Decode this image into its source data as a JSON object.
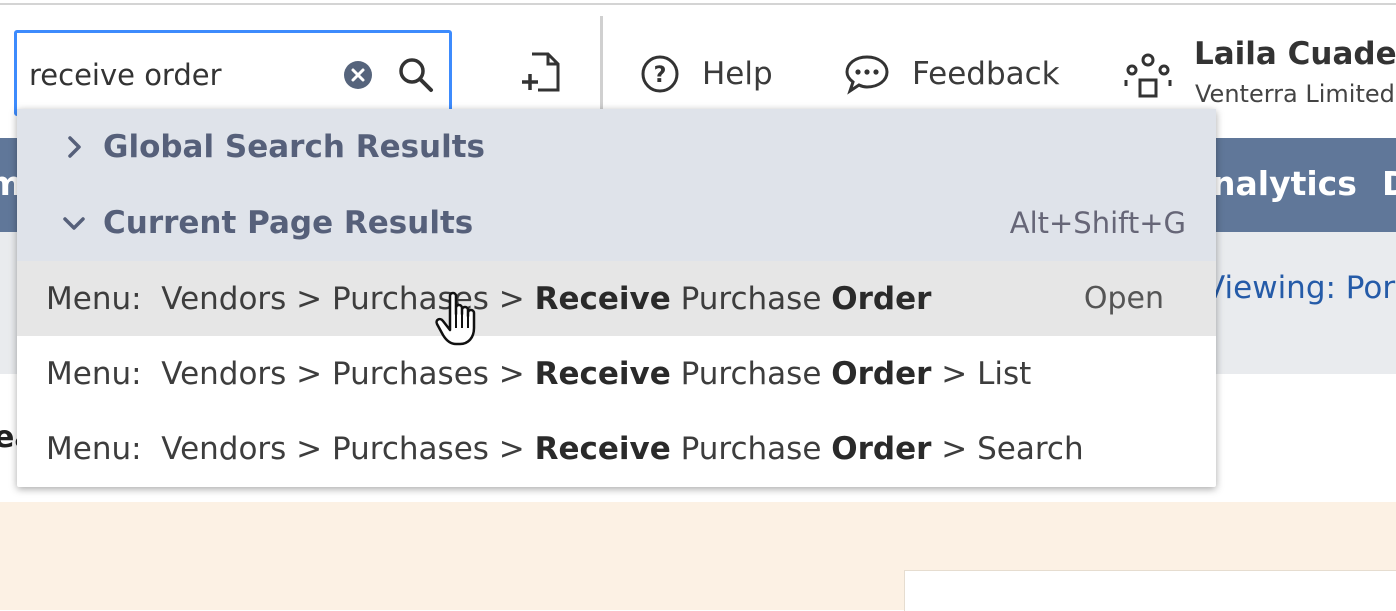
{
  "search": {
    "value": "receive order"
  },
  "header": {
    "help_label": "Help",
    "feedback_label": "Feedback",
    "user_name": "Laila Cuadern",
    "user_company": "Venterra Limited"
  },
  "nav": {
    "left_partial": "m",
    "analytics_partial": "nalytics",
    "right_partial": "D"
  },
  "subbar": {
    "viewing_partial": "Viewing: Port"
  },
  "page": {
    "fragment": "ea"
  },
  "dropdown": {
    "global_section": "Global Search Results",
    "current_section": "Current Page Results",
    "shortcut": "Alt+Shift+G",
    "results": [
      {
        "prefix": "Menu:  Vendors > Purchases > ",
        "b1": "Receive",
        "mid": " Purchase ",
        "b2": "Order",
        "suffix": "",
        "action": "Open"
      },
      {
        "prefix": "Menu:  Vendors > Purchases > ",
        "b1": "Receive",
        "mid": " Purchase ",
        "b2": "Order",
        "suffix": " > List"
      },
      {
        "prefix": "Menu:  Vendors > Purchases > ",
        "b1": "Receive",
        "mid": " Purchase ",
        "b2": "Order",
        "suffix": " > Search"
      }
    ]
  },
  "icons": {
    "clear": "clear-icon",
    "search": "search-icon",
    "new_record": "new-record-icon",
    "help": "help-icon",
    "feedback": "feedback-icon",
    "role": "role-switch-icon",
    "chevron_right": "chevron-right-icon",
    "chevron_down": "chevron-down-icon",
    "cursor": "hand-cursor-icon"
  },
  "colors": {
    "focus_border": "#3d8bfd",
    "nav_bg": "#607799",
    "section_bg": "#dfe3ea",
    "hover_row": "#e6e6e6",
    "link": "#255ba8",
    "peach": "#fcf1e4"
  }
}
